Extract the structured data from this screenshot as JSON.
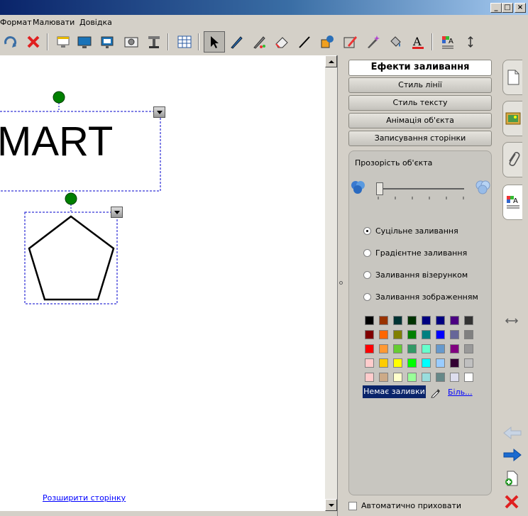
{
  "menu": {
    "items": [
      "Формат",
      "Малювати",
      "Довідка"
    ]
  },
  "window_buttons": {
    "minimize": "_",
    "maximize": "□",
    "close": "×"
  },
  "canvas": {
    "text_object": "MART",
    "expand_link": "Розширити сторінку"
  },
  "panel": {
    "sections": [
      "Ефекти заливання",
      "Стиль лінії",
      "Стиль тексту",
      "Анімація об'єкта",
      "Записування сторінки"
    ],
    "transparency_label": "Прозорість об'єкта",
    "fill_options": [
      "Суцільне заливання",
      "Градієнтне заливання",
      "Заливання візерунком",
      "Заливання зображенням"
    ],
    "selected_fill": "Суцільне заливання",
    "no_fill": "Немає заливки",
    "more_colors": "Біль...",
    "auto_hide": "Автоматично приховати",
    "transparency_value": 0.0
  },
  "palette": [
    [
      "#000000",
      "#993300",
      "#003333",
      "#003300",
      "#000080",
      "#000080",
      "#4b0082",
      "#333333"
    ],
    [
      "#800000",
      "#ff6600",
      "#808000",
      "#008000",
      "#008080",
      "#0000ff",
      "#666699",
      "#808080"
    ],
    [
      "#ff0000",
      "#ff9933",
      "#66cc33",
      "#339966",
      "#66ffcc",
      "#6699cc",
      "#800080",
      "#999999"
    ],
    [
      "#ffcccc",
      "#ffcc00",
      "#ffff00",
      "#00ff00",
      "#00ffff",
      "#99ccff",
      "#330033",
      "#c0c0c0"
    ],
    [
      "#ffcccc",
      "#ccaa88",
      "#ffffcc",
      "#99ff99",
      "#99dddd",
      "#668888",
      "#ddddee",
      "#ffffff"
    ]
  ],
  "colors": {
    "title_start": "#0a246a",
    "title_end": "#a6caf0",
    "handle_green": "#008000",
    "selection": "#0000cc"
  }
}
